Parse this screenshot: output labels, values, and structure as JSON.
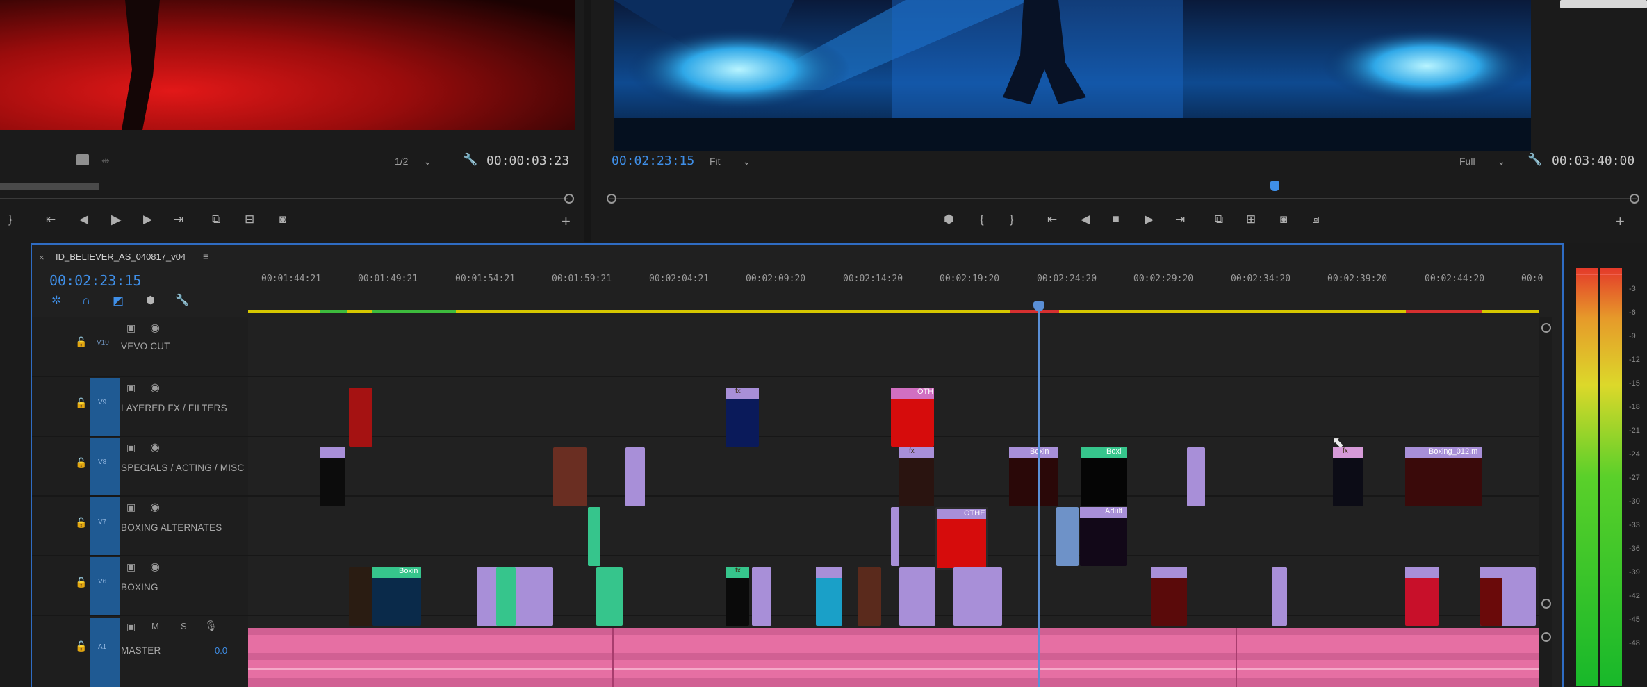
{
  "source_monitor": {
    "resolution": "1/2",
    "timecode_end": "00:00:03:23"
  },
  "program_monitor": {
    "timecode_current": "00:02:23:15",
    "zoom": "Fit",
    "resolution": "Full",
    "timecode_end": "00:03:40:00"
  },
  "timeline": {
    "sequence_name": "ID_BELIEVER_AS_040817_v04",
    "close_glyph": "×",
    "menu_glyph": "≡",
    "current_timecode": "00:02:23:15",
    "ruler_ticks": [
      "00:01:44:21",
      "00:01:49:21",
      "00:01:54:21",
      "00:01:59:21",
      "00:02:04:21",
      "00:02:09:20",
      "00:02:14:20",
      "00:02:19:20",
      "00:02:24:20",
      "00:02:29:20",
      "00:02:34:20",
      "00:02:39:20",
      "00:02:44:20",
      "00:0"
    ],
    "tracks": [
      {
        "id": "V10",
        "name": "VEVO CUT"
      },
      {
        "id": "V9",
        "name": "LAYERED FX / FILTERS"
      },
      {
        "id": "V8",
        "name": "SPECIALS / ACTING / MISC"
      },
      {
        "id": "V7",
        "name": "BOXING ALTERNATES"
      },
      {
        "id": "V6",
        "name": "BOXING"
      },
      {
        "id": "A1",
        "name": "MASTER",
        "volume": "0.0",
        "mute": "M",
        "solo": "S"
      }
    ],
    "clip_labels": {
      "v9_other": "OTH",
      "v8_boxing_a": "Boxin",
      "v8_boxing_b": "Boxi",
      "v8_boxing_012": "Boxing_012.m",
      "v7_other": "OTHE",
      "v7_adult": "Adult",
      "v6_boxin": "Boxin",
      "fx_badge": "fx"
    }
  },
  "audio_meter": {
    "labels": [
      "-3",
      "-6",
      "-9",
      "-12",
      "-15",
      "-18",
      "-21",
      "-24",
      "-27",
      "-30",
      "-33",
      "-36",
      "-39",
      "-42",
      "-45",
      "-48"
    ]
  },
  "colors": {
    "accent_blue": "#3f8fe8",
    "playhead_blue": "#5a8fd6",
    "clip_violet": "#a88fd8",
    "clip_mint": "#36c58c",
    "clip_red": "#d01515",
    "audio_pink": "#e66fa3",
    "track_header_blue": "#1f5a93"
  }
}
